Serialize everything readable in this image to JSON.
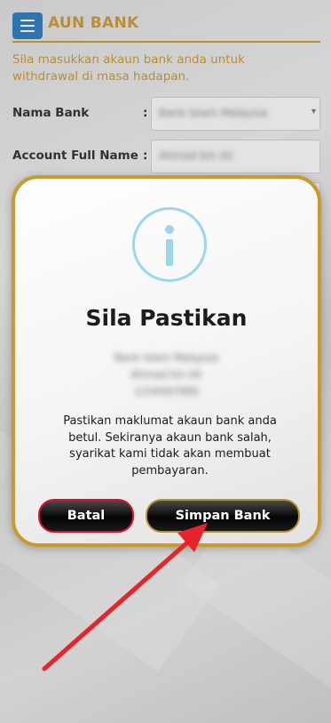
{
  "page": {
    "title": "AUN BANK",
    "instructions": "Sila masukkan akaun bank anda untuk withdrawal di masa hadapan.",
    "colon": ":",
    "fields": [
      {
        "label": "Nama Bank",
        "value": "Bank Islam Malaysia"
      },
      {
        "label": "Account Full Name",
        "value": "Ahmad bin Ali"
      }
    ]
  },
  "modal": {
    "icon": "info-icon",
    "title": "Sila Pastikan",
    "account_lines": [
      "Bank Islam Malaysia",
      "Ahmad bin Ali",
      "1234567890"
    ],
    "message": "Pastikan maklumat akaun bank anda betul. Sekiranya akaun bank salah, syarikat kami tidak akan membuat pembayaran.",
    "cancel_label": "Batal",
    "save_label": "Simpan Bank"
  },
  "colors": {
    "accent_gold": "#c8922a",
    "menu_blue": "#1e73be",
    "info_icon": "#9bd6ee",
    "cancel_border": "#d8102a",
    "annotation_arrow": "#e8232b"
  }
}
